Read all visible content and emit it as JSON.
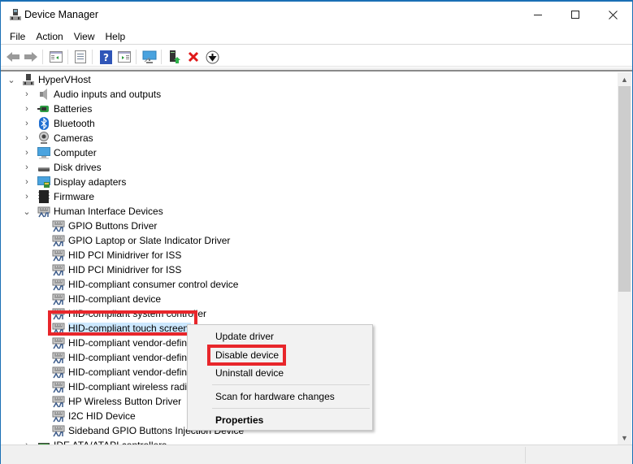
{
  "window": {
    "title": "Device Manager",
    "controls": {
      "minimize": "—",
      "maximize": "☐",
      "close": "✕"
    }
  },
  "menubar": {
    "items": [
      {
        "label": "File"
      },
      {
        "label": "Action"
      },
      {
        "label": "View"
      },
      {
        "label": "Help"
      }
    ]
  },
  "toolbar": {
    "buttons": [
      {
        "name": "back",
        "icon": "arrow-left-icon",
        "enabled": false
      },
      {
        "name": "forward",
        "icon": "arrow-right-icon",
        "enabled": false
      },
      {
        "name": "show-hide-console-tree",
        "icon": "console-tree-icon"
      },
      {
        "name": "properties",
        "icon": "properties-sheet-icon"
      },
      {
        "name": "help",
        "icon": "help-icon",
        "glyph": "?"
      },
      {
        "name": "show-action-pane",
        "icon": "action-pane-icon"
      },
      {
        "name": "scan-hardware",
        "icon": "monitor-scan-icon"
      },
      {
        "name": "update-driver",
        "icon": "update-driver-icon"
      },
      {
        "name": "uninstall-device",
        "icon": "red-x-icon",
        "glyph": "✕"
      },
      {
        "name": "disable-device",
        "icon": "down-arrow-circle-icon",
        "glyph": "⬇"
      }
    ]
  },
  "tree": {
    "root": {
      "label": "HyperVHost",
      "expanded": true,
      "icon": "computer-host-icon"
    },
    "categories": [
      {
        "label": "Audio inputs and outputs",
        "icon": "speaker-icon",
        "expanded": false
      },
      {
        "label": "Batteries",
        "icon": "battery-icon",
        "expanded": false
      },
      {
        "label": "Bluetooth",
        "icon": "bluetooth-icon",
        "expanded": false
      },
      {
        "label": "Cameras",
        "icon": "camera-icon",
        "expanded": false
      },
      {
        "label": "Computer",
        "icon": "monitor-icon",
        "expanded": false
      },
      {
        "label": "Disk drives",
        "icon": "disk-drive-icon",
        "expanded": false
      },
      {
        "label": "Display adapters",
        "icon": "display-adapter-icon",
        "expanded": false
      },
      {
        "label": "Firmware",
        "icon": "firmware-icon",
        "expanded": false
      },
      {
        "label": "Human Interface Devices",
        "icon": "hid-icon",
        "expanded": true
      }
    ],
    "hid_children": [
      {
        "label": "GPIO Buttons Driver"
      },
      {
        "label": "GPIO Laptop or Slate Indicator Driver"
      },
      {
        "label": "HID PCI Minidriver for ISS"
      },
      {
        "label": "HID PCI Minidriver for ISS"
      },
      {
        "label": "HID-compliant consumer control device"
      },
      {
        "label": "HID-compliant device"
      },
      {
        "label": "HID-compliant system controller"
      },
      {
        "label": "HID-compliant touch screen",
        "selected": true
      },
      {
        "label": "HID-compliant vendor-defined device"
      },
      {
        "label": "HID-compliant vendor-defined device"
      },
      {
        "label": "HID-compliant vendor-defined device"
      },
      {
        "label": "HID-compliant wireless radio controls"
      },
      {
        "label": "HP Wireless Button Driver"
      },
      {
        "label": "I2C HID Device"
      },
      {
        "label": "Sideband GPIO Buttons Injection Device"
      }
    ],
    "after": [
      {
        "label": "IDE ATA/ATAPI controllers",
        "icon": "ide-controller-icon",
        "expanded": false
      }
    ]
  },
  "context_menu": {
    "items": [
      {
        "label": "Update driver"
      },
      {
        "label": "Disable device",
        "highlighted": true
      },
      {
        "label": "Uninstall device"
      },
      {
        "label": "Scan for hardware changes"
      },
      {
        "label": "Properties",
        "bold": true
      }
    ]
  },
  "scrollbar": {
    "position_fraction": 0.0,
    "visible_fraction": 0.6
  },
  "colors": {
    "accent_border": "#1a6fb5",
    "selection": "#cce8ff",
    "annotation_red": "#e8262b"
  }
}
